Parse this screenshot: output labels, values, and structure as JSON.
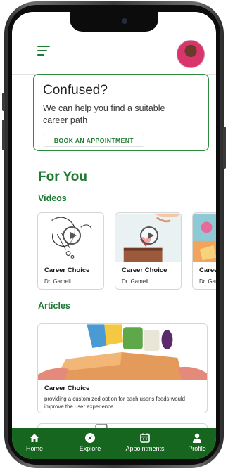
{
  "header": {
    "menu_icon": "hamburger-menu-icon",
    "avatar": "user-avatar"
  },
  "promo": {
    "title": "Confused?",
    "text": "We can help you find a suitable career path",
    "button_label": "BOOK AN APPOINTMENT"
  },
  "for_you": {
    "heading": "For You"
  },
  "videos": {
    "heading": "Videos",
    "items": [
      {
        "title": "Career Choice",
        "author": "Dr. Gameli"
      },
      {
        "title": "Career Choice",
        "author": "Dr. Gameli"
      },
      {
        "title": "Caree",
        "author": "Dr. Gar"
      }
    ]
  },
  "articles": {
    "heading": "Articles",
    "items": [
      {
        "title": "Career Choice",
        "description": "providing a customized option for each user's feeds would improve the user experience"
      }
    ]
  },
  "nav": {
    "items": [
      {
        "label": "Home",
        "icon": "home-icon"
      },
      {
        "label": "Explore",
        "icon": "compass-icon"
      },
      {
        "label": "Appointments",
        "icon": "calendar-icon"
      },
      {
        "label": "Profile",
        "icon": "person-icon"
      }
    ]
  },
  "colors": {
    "brand_green": "#1f7a34",
    "nav_bar": "#17661f"
  }
}
